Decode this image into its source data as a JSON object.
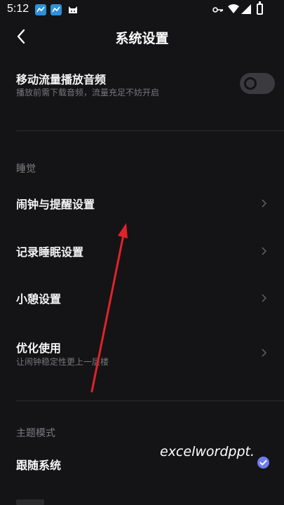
{
  "status_bar": {
    "time": "5:12",
    "icons": [
      "app-icon-1",
      "app-icon-2",
      "cat-icon",
      "key-icon",
      "wifi-icon",
      "signal-icon",
      "battery-icon"
    ]
  },
  "header": {
    "title": "系统设置",
    "back_icon": "back-icon"
  },
  "mobile_data_audio": {
    "title": "移动流量播放音频",
    "subtitle": "播放前需下载音频，流量充足不妨开启",
    "toggle_on": false
  },
  "sleep_section": {
    "label": "睡觉",
    "items": [
      {
        "title": "闹钟与提醒设置"
      },
      {
        "title": "记录睡眠设置"
      },
      {
        "title": "小憩设置"
      },
      {
        "title": "优化使用",
        "subtitle": "让闹钟稳定性更上一层楼"
      }
    ]
  },
  "theme_section": {
    "label": "主题模式",
    "selected": {
      "title": "跟随系统",
      "checked": true
    }
  },
  "watermark": "excelwordppt.",
  "colors": {
    "background": "#141416",
    "accent_check": "#6d7cf0",
    "annotation_arrow": "#e0232a"
  }
}
